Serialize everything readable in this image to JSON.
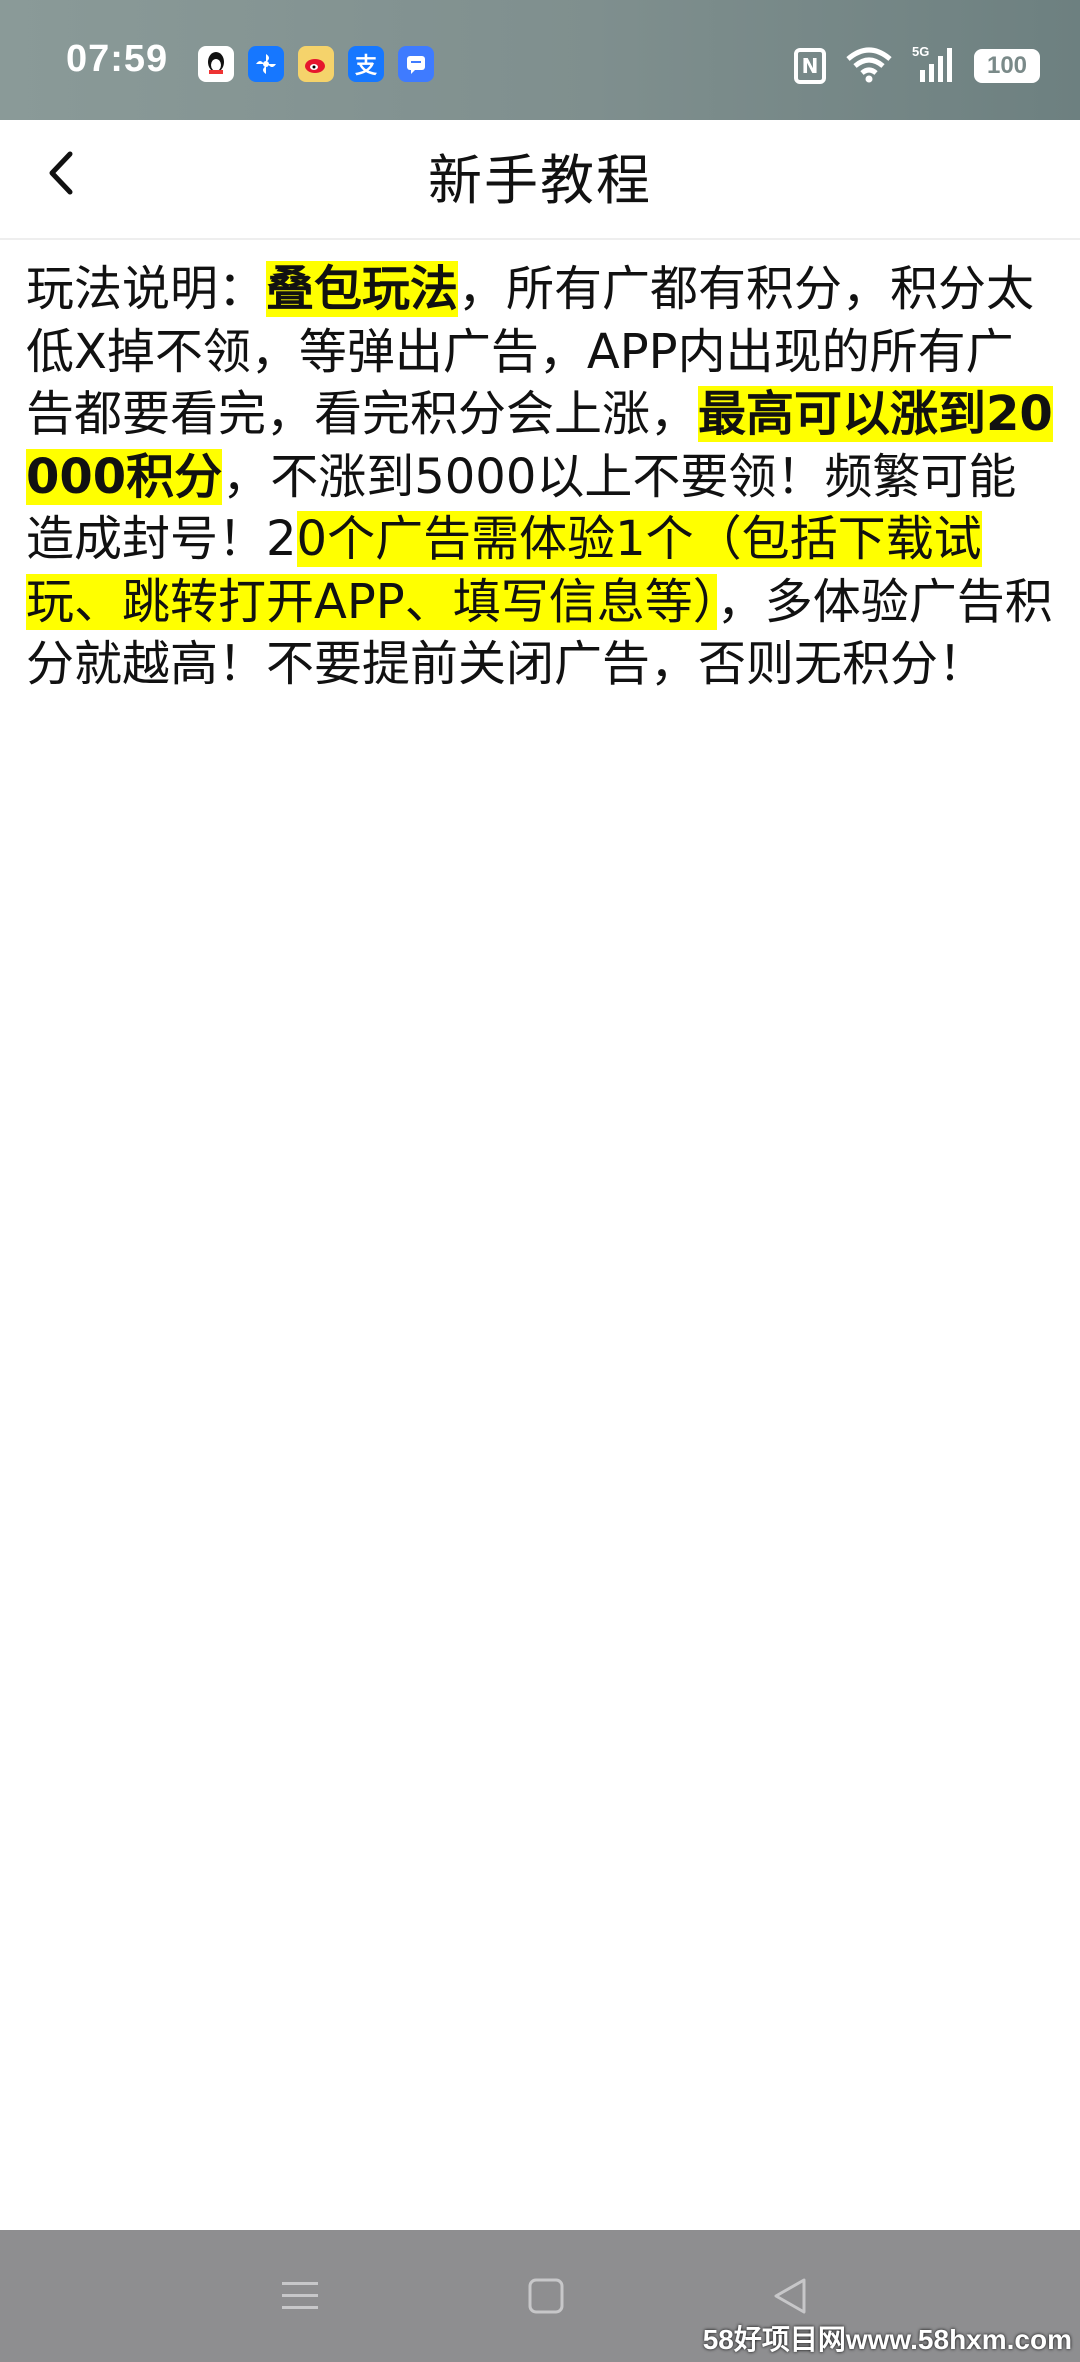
{
  "status_bar": {
    "time": "07:59",
    "notification_icons": [
      "qq-icon",
      "fan-app-icon",
      "weibo-icon",
      "alipay-icon",
      "message-icon"
    ],
    "alipay_glyph": "支",
    "battery": "100",
    "nfc_glyph": "N"
  },
  "header": {
    "title": "新手教程"
  },
  "content": {
    "seg1": "玩法说明：",
    "seg2_highlight_bold": "叠包玩法",
    "seg3": "，所有广都有积分，积分太低X掉不领，等弹出广告，APP内出现的所有广告都要看完，看完积分会上涨，",
    "seg4_highlight_bold": "最高可以涨到20000积分",
    "seg5": "，不涨到5000以上不要领！频繁可能造成封号！2",
    "seg6_highlight": "0个广告需体验1个（包括下载试玩、跳转打开APP、填写信息等）",
    "seg7": "，多体验广告积分就越高！不要提前关闭广告，否则无积分！"
  },
  "nav_bar": {
    "buttons": [
      "menu-icon",
      "home-icon",
      "back-triangle-icon"
    ]
  },
  "watermark": "58好项目网www.58hxm.com",
  "colors": {
    "highlight": "#ffff00",
    "status_bar": "#7f8f8e",
    "nav_bar": "#8e8e90"
  }
}
